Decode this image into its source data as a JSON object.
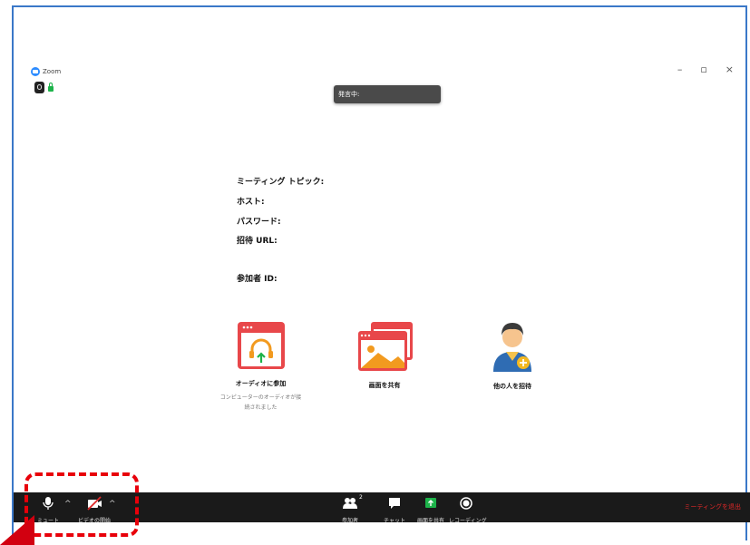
{
  "window": {
    "title": "Zoom",
    "controls": {
      "minimize": "–",
      "maximize": "▫",
      "close": "×"
    }
  },
  "speaking": {
    "label": "発言中:"
  },
  "meeting_info": {
    "topic_label": "ミーティング トピック:",
    "host_label": "ホスト:",
    "password_label": "パスワード:",
    "invite_url_label": "招待 URL:",
    "participant_id_label": "参加者 ID:"
  },
  "actions": {
    "audio": {
      "label": "オーディオに参加",
      "sub1": "コンピューターのオーディオが接",
      "sub2": "続されました"
    },
    "share": {
      "label": "画面を共有"
    },
    "invite": {
      "label": "他の人を招待"
    }
  },
  "toolbar": {
    "mute_label": "ミュート",
    "video_label": "ビデオの開始",
    "participants_label": "参加者",
    "participants_count": "2",
    "chat_label": "チャット",
    "share_label": "画面を共有",
    "record_label": "レコーディング",
    "end_label": "ミーティングを退出"
  },
  "colors": {
    "toolbar_bg": "#1a1a1a",
    "accent_red": "#e8000a",
    "share_green": "#1db34a",
    "icon_red": "#e8474a",
    "frame_blue": "#3a78c8"
  }
}
